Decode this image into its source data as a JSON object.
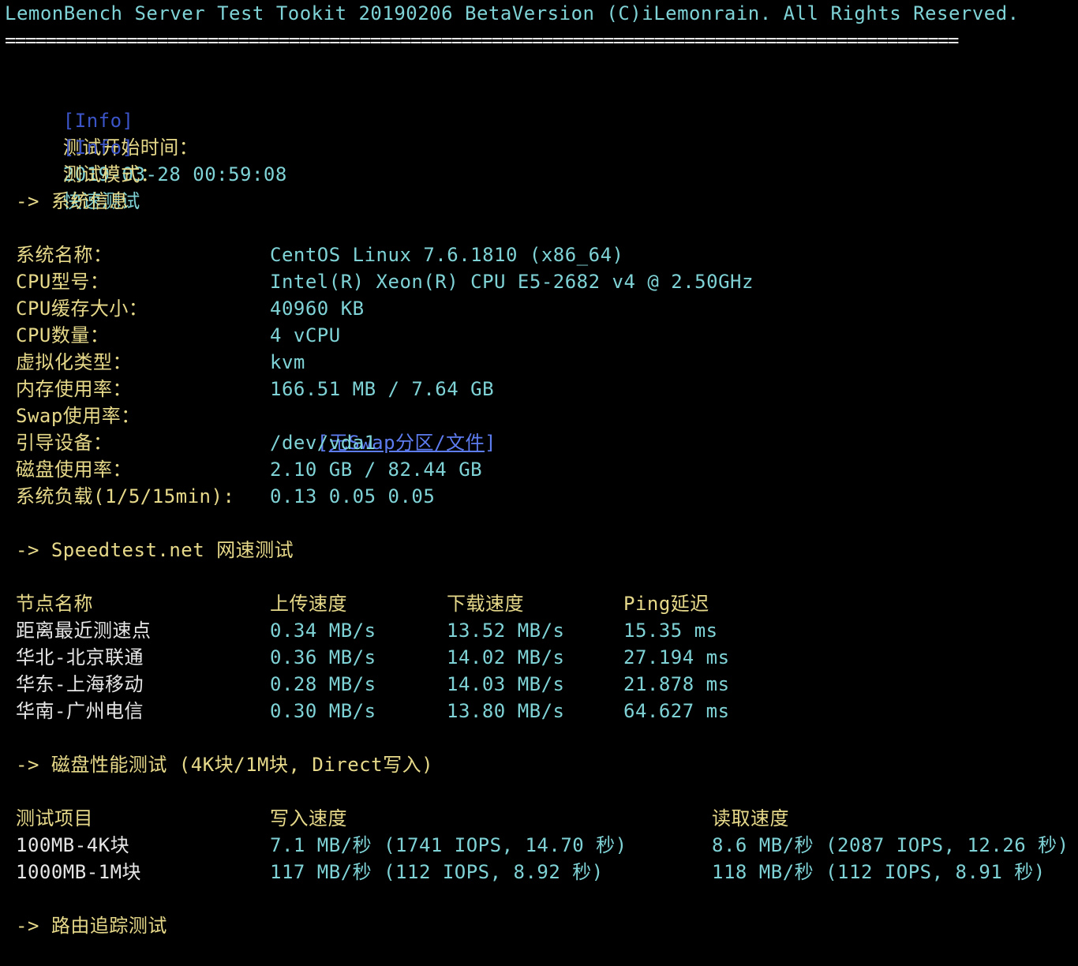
{
  "header": {
    "title_text": "LemonBench Server Test Tookit 20190206 BetaVersion (C)iLemonrain. All Rights Reserved.",
    "rule": "=============================================================================================="
  },
  "info": {
    "tag": "[Info]",
    "start_label": "测试开始时间：",
    "start_value": "2019-03-28 00:59:08",
    "mode_label": "测试模式：",
    "mode_value": "快速测试"
  },
  "system": {
    "section_title": "-> 系统信息",
    "rows": [
      {
        "label": "系统名称：",
        "value": "CentOS Linux 7.6.1810 (x86_64)"
      },
      {
        "label": "CPU型号：",
        "value": "Intel(R) Xeon(R) CPU E5-2682 v4 @ 2.50GHz"
      },
      {
        "label": "CPU缓存大小：",
        "value": "40960 KB"
      },
      {
        "label": "CPU数量：",
        "value": "4 vCPU"
      },
      {
        "label": "虚拟化类型：",
        "value": "kvm"
      },
      {
        "label": "内存使用率：",
        "value": "166.51 MB / 7.64 GB"
      },
      {
        "label": "Swap使用率：",
        "value_prefix": "[",
        "value_link": "无Swap分区/文件",
        "value_suffix": "]"
      },
      {
        "label": "引导设备：",
        "value": "/dev/vda1"
      },
      {
        "label": "磁盘使用率：",
        "value": "2.10 GB / 82.44 GB"
      },
      {
        "label": "系统负载(1/5/15min):",
        "value": "0.13 0.05 0.05"
      }
    ]
  },
  "speedtest": {
    "section_title": "-> Speedtest.net 网速测试",
    "headers": [
      "节点名称",
      "上传速度",
      "下载速度",
      "Ping延迟"
    ],
    "rows": [
      {
        "node": "距离最近测速点",
        "up": "0.34 MB/s",
        "down": "13.52 MB/s",
        "ping": "15.35 ms"
      },
      {
        "node": "华北-北京联通",
        "up": "0.36 MB/s",
        "down": "14.02 MB/s",
        "ping": "27.194 ms"
      },
      {
        "node": "华东-上海移动",
        "up": "0.28 MB/s",
        "down": "14.03 MB/s",
        "ping": "21.878 ms"
      },
      {
        "node": "华南-广州电信",
        "up": "0.30 MB/s",
        "down": "13.80 MB/s",
        "ping": "64.627 ms"
      }
    ]
  },
  "disk": {
    "section_title": "-> 磁盘性能测试 (4K块/1M块, Direct写入)",
    "headers": [
      "测试项目",
      "写入速度",
      "读取速度"
    ],
    "rows": [
      {
        "item": "100MB-4K块",
        "write": "7.1 MB/秒 (1741 IOPS, 14.70 秒)",
        "read": "8.6 MB/秒 (2087 IOPS, 12.26 秒)"
      },
      {
        "item": "1000MB-1M块",
        "write": "117 MB/秒 (112 IOPS, 8.92 秒)",
        "read": "118 MB/秒 (112 IOPS, 8.91 秒)"
      }
    ]
  },
  "route": {
    "section_title": "-> 路由追踪测试"
  },
  "colors": {
    "background": "#000000",
    "label": "#e7d98a",
    "value": "#7fd3d6",
    "info_tag": "#3b55c8",
    "link": "#5d7cf0"
  }
}
